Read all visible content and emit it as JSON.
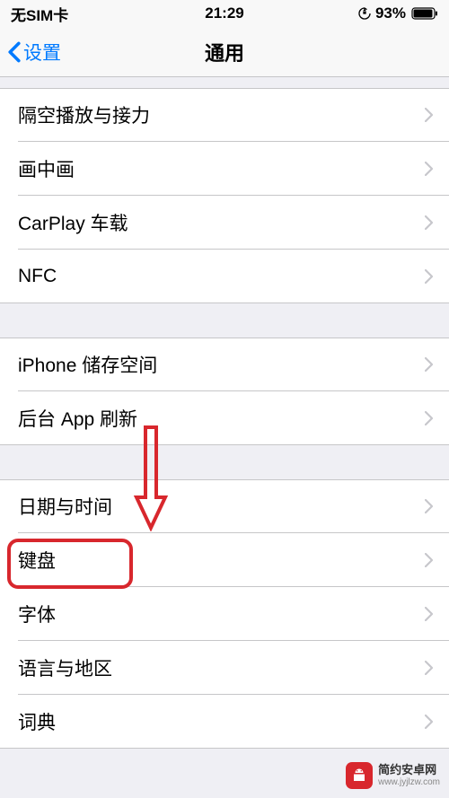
{
  "status": {
    "carrier": "无SIM卡",
    "time": "21:29",
    "battery_pct": "93%"
  },
  "nav": {
    "back_label": "设置",
    "title": "通用"
  },
  "rows": {
    "airplay": "隔空播放与接力",
    "pip": "画中画",
    "carplay": "CarPlay 车载",
    "nfc": "NFC",
    "storage": "iPhone 储存空间",
    "bg_refresh": "后台 App 刷新",
    "date_time": "日期与时间",
    "keyboard": "键盘",
    "font": "字体",
    "lang_region": "语言与地区",
    "dictionary": "词典"
  },
  "watermark": {
    "title": "简约安卓网",
    "url": "www.jyjlzw.com"
  }
}
